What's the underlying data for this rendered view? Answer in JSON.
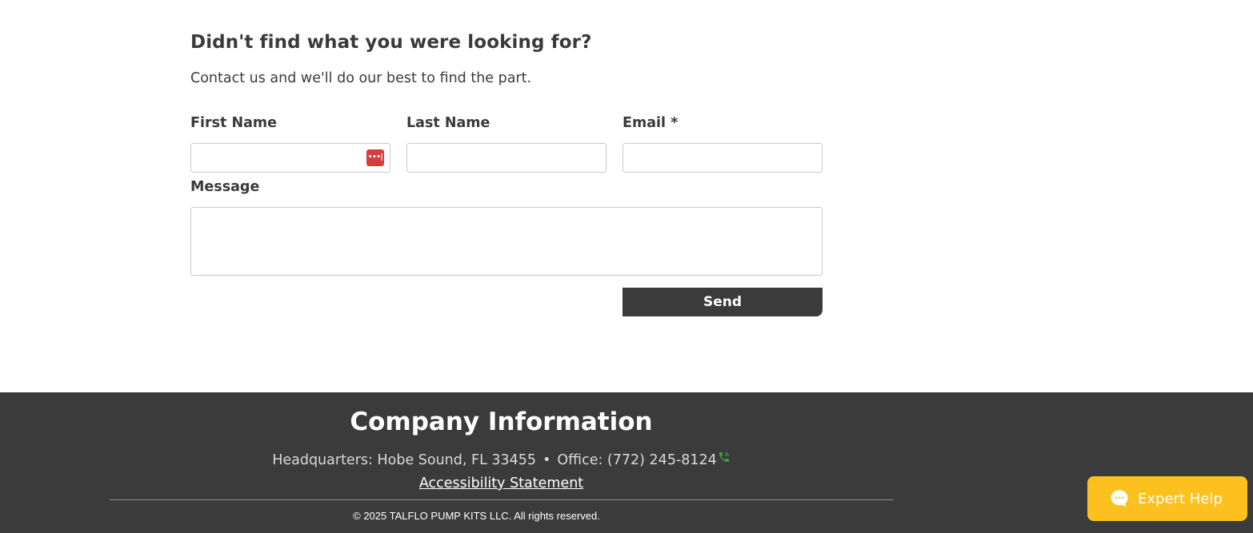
{
  "contact": {
    "heading": "Didn't find what you were looking for?",
    "subheading": "Contact us and we'll do our best to find the part.",
    "fields": {
      "first_name": {
        "label": "First Name",
        "value": "",
        "placeholder": ""
      },
      "last_name": {
        "label": "Last Name",
        "value": "",
        "placeholder": ""
      },
      "email": {
        "label": "Email *",
        "value": "",
        "placeholder": ""
      },
      "message": {
        "label": "Message",
        "value": "",
        "placeholder": ""
      }
    },
    "password_manager_icon": "password-manager-icon",
    "send_label": "Send"
  },
  "footer": {
    "title": "Company Information",
    "headquarters": "Headquarters: Hobe Sound, FL 33455",
    "separator": "•",
    "office": "Office: (772) 245-8124",
    "phone_icon": "phone-icon",
    "accessibility_link": "Accessibility Statement",
    "copyright": "© 2025 TALFLO PUMP KITS LLC. All rights reserved."
  },
  "chat_widget": {
    "label": "Expert Help",
    "icon": "chat-bubble-icon"
  },
  "colors": {
    "footer_bg": "#3b3b3b",
    "send_bg": "#3b3b3b",
    "expert_bg": "#fcc01f",
    "phone_icon": "#3fa04a",
    "password_icon": "#d93c3c"
  }
}
